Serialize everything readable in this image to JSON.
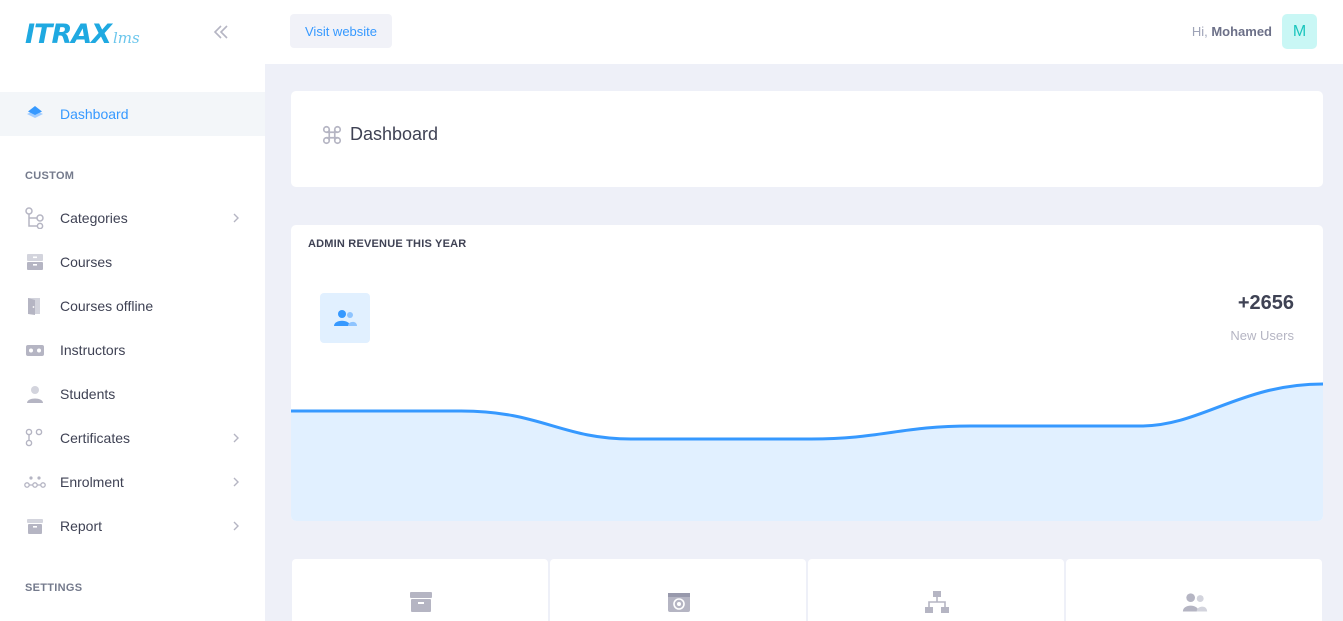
{
  "brand": {
    "name": "ITRAX",
    "suffix": "lms"
  },
  "sidebar": {
    "active_item": {
      "label": "Dashboard",
      "icon": "layers-icon"
    },
    "sections": [
      {
        "title": "CUSTOM"
      },
      {
        "title": "SETTINGS"
      }
    ],
    "items": [
      {
        "label": "Categories",
        "icon": "hierarchy-icon",
        "has_submenu": true
      },
      {
        "label": "Courses",
        "icon": "archive-icon",
        "has_submenu": false
      },
      {
        "label": "Courses offline",
        "icon": "door-icon",
        "has_submenu": false
      },
      {
        "label": "Instructors",
        "icon": "vr-headset-icon",
        "has_submenu": false
      },
      {
        "label": "Students",
        "icon": "user-icon",
        "has_submenu": false
      },
      {
        "label": "Certificates",
        "icon": "nodes-icon",
        "has_submenu": true
      },
      {
        "label": "Enrolment",
        "icon": "flow-icon",
        "has_submenu": true
      },
      {
        "label": "Report",
        "icon": "box-icon",
        "has_submenu": true
      }
    ]
  },
  "header": {
    "visit_label": "Visit website",
    "greeting": "Hi,",
    "user_name": "Mohamed",
    "avatar_letter": "M"
  },
  "subheader": {
    "title": "Dashboard",
    "icon": "command-icon"
  },
  "revenue_card": {
    "title": "ADMIN REVENUE THIS YEAR",
    "value": "+2656",
    "value_label": "New Users",
    "icon": "users-icon"
  },
  "stats": [
    {
      "icon": "archive-icon"
    },
    {
      "icon": "camera-icon"
    },
    {
      "icon": "network-icon"
    },
    {
      "icon": "users-icon"
    }
  ],
  "colors": {
    "accent": "#3699ff",
    "chart_fill": "#e1f0ff",
    "background": "#eef0f8"
  }
}
